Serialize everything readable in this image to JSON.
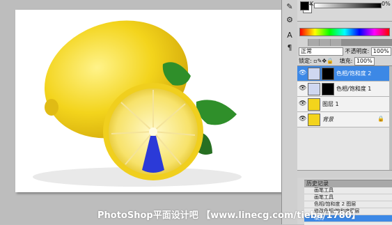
{
  "color_panel": {
    "channel_label": "K",
    "k_value": "0",
    "unit": "%"
  },
  "layers_panel": {
    "blend_mode": "正常",
    "opacity_label": "不透明度:",
    "opacity_value": "100%",
    "lock_label": "锁定:",
    "fill_label": "填充:",
    "fill_value": "100%",
    "layers": [
      {
        "name": "色相/饱和度 2",
        "selected": true
      },
      {
        "name": "色相/饱和度 1",
        "selected": false
      },
      {
        "name": "图层 1",
        "selected": false
      },
      {
        "name": "背景",
        "selected": false
      }
    ]
  },
  "history_panel": {
    "title": "历史记录",
    "items": [
      "画笔工具",
      "画笔工具",
      "色相/饱和度 2 图层",
      "修改色相/饱和度图层",
      "填充"
    ]
  },
  "watermark": "PhotoShop平面设计吧 【www.linecg.com/tieba/1780】",
  "colors": {
    "selection": "#3c88e6",
    "lemon": "#f2d21a",
    "leaf": "#2f8f2a",
    "wedge": "#2b3ad8"
  }
}
